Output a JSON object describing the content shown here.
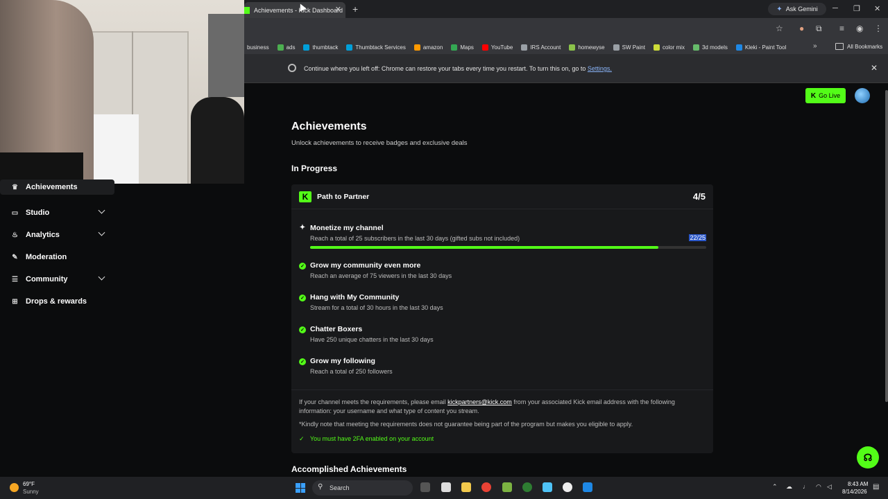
{
  "browser": {
    "tab_title": "Achievements - Kick Dashboard",
    "tab_close": "✕",
    "new_tab": "+",
    "gemini_label": "Ask Gemini",
    "bookmarks": [
      {
        "label": "business",
        "color": "#35363a"
      },
      {
        "label": "ads",
        "color": "#4caf50"
      },
      {
        "label": "thumbtack",
        "color": "#009fd9"
      },
      {
        "label": "Thumbtack Services",
        "color": "#009fd9"
      },
      {
        "label": "amazon",
        "color": "#ff9900"
      },
      {
        "label": "Maps",
        "color": "#34a853"
      },
      {
        "label": "YouTube",
        "color": "#ff0000"
      },
      {
        "label": "IRS Account",
        "color": "#9aa0a6"
      },
      {
        "label": "homewyse",
        "color": "#8bc34a"
      },
      {
        "label": "SW Paint",
        "color": "#9aa0a6"
      },
      {
        "label": "color mix",
        "color": "#cddc39"
      },
      {
        "label": "3d models",
        "color": "#66bb6a"
      },
      {
        "label": "Kleki - Paint Tool",
        "color": "#1e88e5"
      }
    ],
    "all_bookmarks": "All Bookmarks",
    "more_bookmarks": "»",
    "infobar_text": "Continue where you left off: Chrome can restore your tabs every time you restart. To turn this on, go to",
    "infobar_link": "Settings.",
    "infobar_close": "✕"
  },
  "sidebar": {
    "items": [
      {
        "label": "Achievements",
        "icon": "trophy-icon",
        "active": true
      },
      {
        "label": "Studio",
        "icon": "studio-icon",
        "chevron": true
      },
      {
        "label": "Analytics",
        "icon": "analytics-icon",
        "chevron": true
      },
      {
        "label": "Moderation",
        "icon": "wrench-icon"
      },
      {
        "label": "Community",
        "icon": "community-icon",
        "chevron": true
      },
      {
        "label": "Drops & rewards",
        "icon": "gift-icon"
      }
    ]
  },
  "header": {
    "go_live": "Go Live",
    "go_live_icon": "K"
  },
  "main": {
    "title": "Achievements",
    "subtitle": "Unlock achievements to receive badges and exclusive deals",
    "in_progress_title": "In Progress",
    "card": {
      "icon_letter": "K",
      "title": "Path to Partner",
      "progress": "4/5",
      "tasks": [
        {
          "name": "Monetize my channel",
          "desc": "Reach a total of 25 subscribers in the last 30 days (gifted subs not included)",
          "count": "22/25",
          "current": 22,
          "target": 25,
          "done": false
        },
        {
          "name": "Grow my community even more",
          "desc": "Reach an average of 75 viewers in the last 30 days",
          "done": true
        },
        {
          "name": "Hang with My Community",
          "desc": "Stream for a total of 30 hours in the last 30 days",
          "done": true
        },
        {
          "name": "Chatter Boxers",
          "desc": "Have 250 unique chatters in the last 30 days",
          "done": true
        },
        {
          "name": "Grow my following",
          "desc": "Reach a total of 250 followers",
          "done": true
        }
      ],
      "note_prefix": "If your channel meets the requirements, please email",
      "note_email": "kickpartners@kick.com",
      "note_suffix": "from your associated Kick email address with the following information: your username and what type of content you stream.",
      "note2": "*Kindly note that meeting the requirements does not guarantee being part of the program but makes you eligible to apply.",
      "twofa": "You must have 2FA enabled on your account"
    },
    "accomplished_title": "Accomplished Achievements"
  },
  "taskbar": {
    "temp": "69°F",
    "condition": "Sunny",
    "search": "Search",
    "time": "8:43 AM",
    "date": "8/14/2026"
  },
  "colors": {
    "accent": "#53fc18",
    "background": "#0b0c0d",
    "card": "#18191b"
  }
}
